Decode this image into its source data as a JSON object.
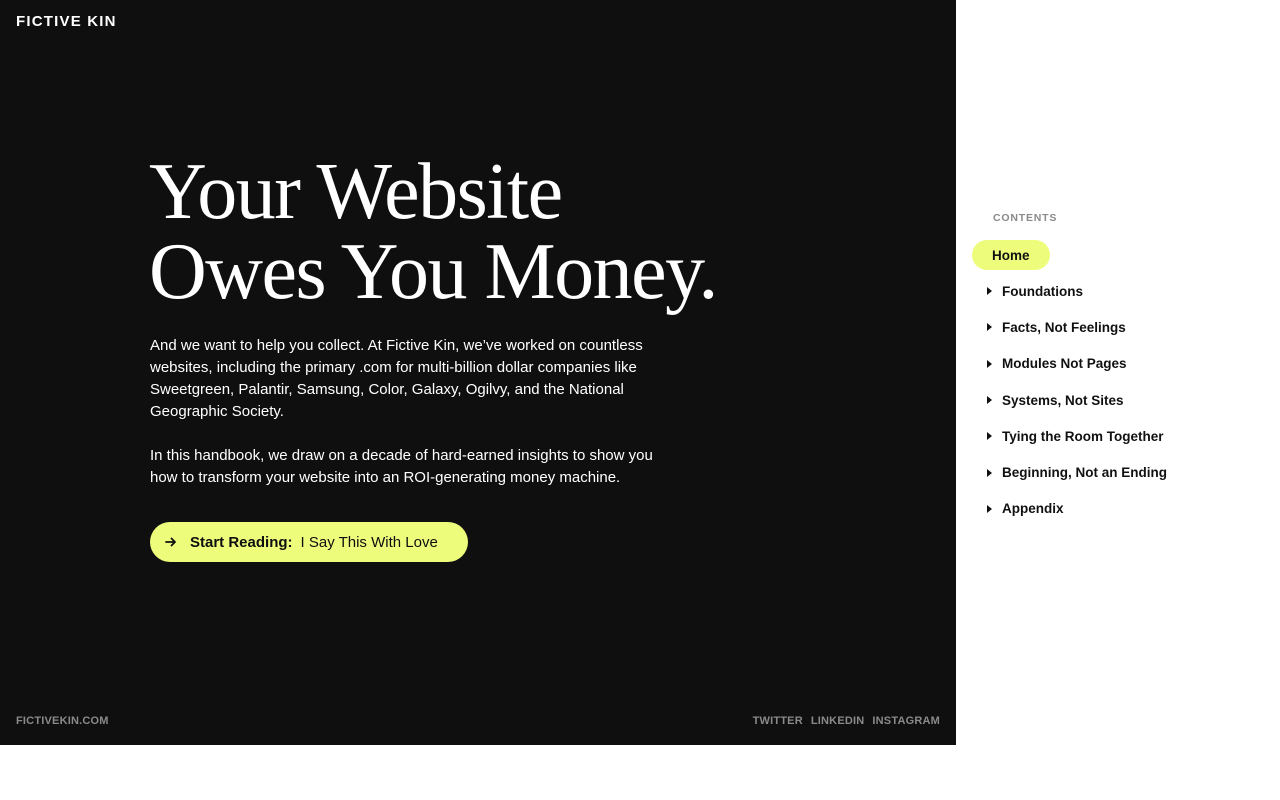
{
  "header": {
    "logo": "FICTIVE KIN"
  },
  "hero": {
    "headline_line1": "Your Website",
    "headline_line2": "Owes You Money.",
    "paragraphs": [
      "And we want to help you collect. At Fictive Kin, we’ve worked on countless websites, including the primary .com for multi-billion dollar companies like Sweetgreen, Palantir, Samsung, Color, Galaxy, Ogilvy, and the National Geographic Society.",
      "In this handbook, we draw on a decade of hard-earned insights to show you how to transform your website into an ROI-generating money machine."
    ],
    "cta": {
      "icon": "arrow-right-icon",
      "label": "Start Reading:",
      "title": "I Say This With Love"
    }
  },
  "footer": {
    "site_link": "FICTIVEKIN.COM",
    "social": [
      "TWITTER",
      "LINKEDIN",
      "INSTAGRAM"
    ]
  },
  "toc": {
    "heading": "CONTENTS",
    "items": [
      {
        "label": "Home",
        "active": true
      },
      {
        "label": "Foundations",
        "active": false
      },
      {
        "label": "Facts, Not Feelings",
        "active": false
      },
      {
        "label": "Modules Not Pages",
        "active": false
      },
      {
        "label": "Systems, Not Sites",
        "active": false
      },
      {
        "label": "Tying the Room Together",
        "active": false
      },
      {
        "label": "Beginning, Not an Ending",
        "active": false
      },
      {
        "label": "Appendix",
        "active": false
      }
    ]
  },
  "colors": {
    "hero_bg": "#0f0f0f",
    "accent": "#eefc7c",
    "muted_text": "#8a8a8a"
  }
}
